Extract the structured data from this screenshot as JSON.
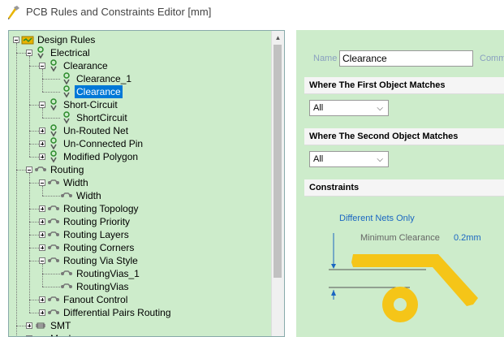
{
  "window": {
    "title": "PCB Rules and Constraints Editor [mm]"
  },
  "tree": {
    "selected": "Clearance",
    "rows": [
      {
        "label": "Design Rules"
      },
      {
        "label": "Electrical"
      },
      {
        "label": "Clearance"
      },
      {
        "label": "Clearance_1"
      },
      {
        "label": "Clearance"
      },
      {
        "label": "Short-Circuit"
      },
      {
        "label": "ShortCircuit"
      },
      {
        "label": "Un-Routed Net"
      },
      {
        "label": "Un-Connected Pin"
      },
      {
        "label": "Modified Polygon"
      },
      {
        "label": "Routing"
      },
      {
        "label": "Width"
      },
      {
        "label": "Width"
      },
      {
        "label": "Routing Topology"
      },
      {
        "label": "Routing Priority"
      },
      {
        "label": "Routing Layers"
      },
      {
        "label": "Routing Corners"
      },
      {
        "label": "Routing Via Style"
      },
      {
        "label": "RoutingVias_1"
      },
      {
        "label": "RoutingVias"
      },
      {
        "label": "Fanout Control"
      },
      {
        "label": "Differential Pairs Routing"
      },
      {
        "label": "SMT"
      },
      {
        "label": "Mask"
      }
    ]
  },
  "editor": {
    "name_label": "Name",
    "name_value": "Clearance",
    "comment_label": "Comm",
    "first_object": {
      "header": "Where The First Object Matches",
      "selected": "All"
    },
    "second_object": {
      "header": "Where The Second Object Matches",
      "selected": "All"
    },
    "constraints": {
      "header": "Constraints",
      "net_scope": "Different Nets Only",
      "min_clearance_label": "Minimum Clearance",
      "min_clearance_value": "0.2mm"
    }
  },
  "colors": {
    "pane_bg": "#cdeccb",
    "selection": "#0078d7",
    "accent_text": "#1a66c2",
    "copper": "#f5c518"
  }
}
